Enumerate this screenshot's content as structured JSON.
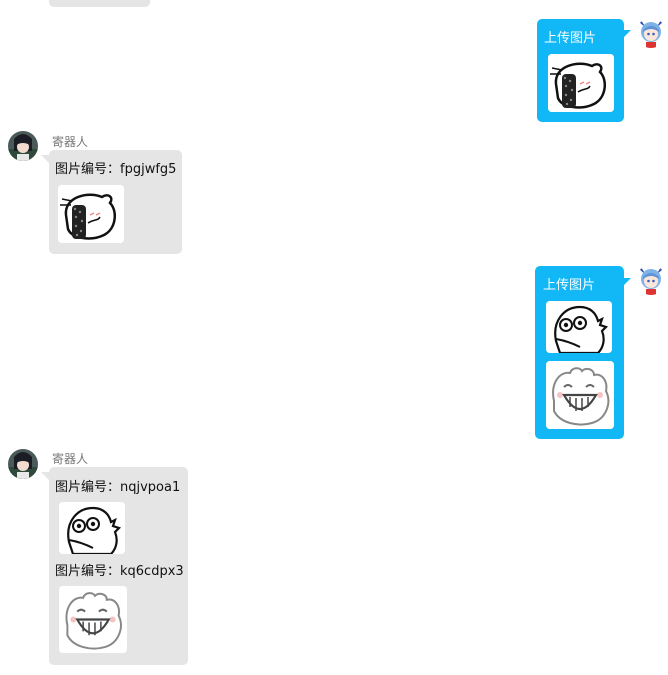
{
  "messages": [
    {
      "id": "bot-partial-top",
      "role": "bot",
      "images": []
    },
    {
      "id": "user-1",
      "role": "user",
      "text": "上传图片",
      "images": [
        {
          "icon": "sticker-face-cover-icon"
        }
      ]
    },
    {
      "id": "bot-1",
      "role": "bot",
      "sender": "寄器人",
      "items": [
        {
          "text": "图片编号：fpgjwfg5",
          "image": "sticker-face-cover-icon"
        }
      ]
    },
    {
      "id": "user-2",
      "role": "user",
      "text": "上传图片",
      "images": [
        {
          "icon": "sticker-dino-face-icon"
        },
        {
          "icon": "sticker-grin-face-icon"
        }
      ]
    },
    {
      "id": "bot-2",
      "role": "bot",
      "sender": "寄器人",
      "items": [
        {
          "text": "图片编号：nqjvpoa1",
          "image": "sticker-dino-face-icon"
        },
        {
          "text": "图片编号：kq6cdpx3",
          "image": "sticker-grin-face-icon"
        }
      ]
    }
  ],
  "colors": {
    "user_bubble": "#12b7f5",
    "bot_bubble": "#e5e5e5",
    "page_bg": "#ffffff"
  }
}
